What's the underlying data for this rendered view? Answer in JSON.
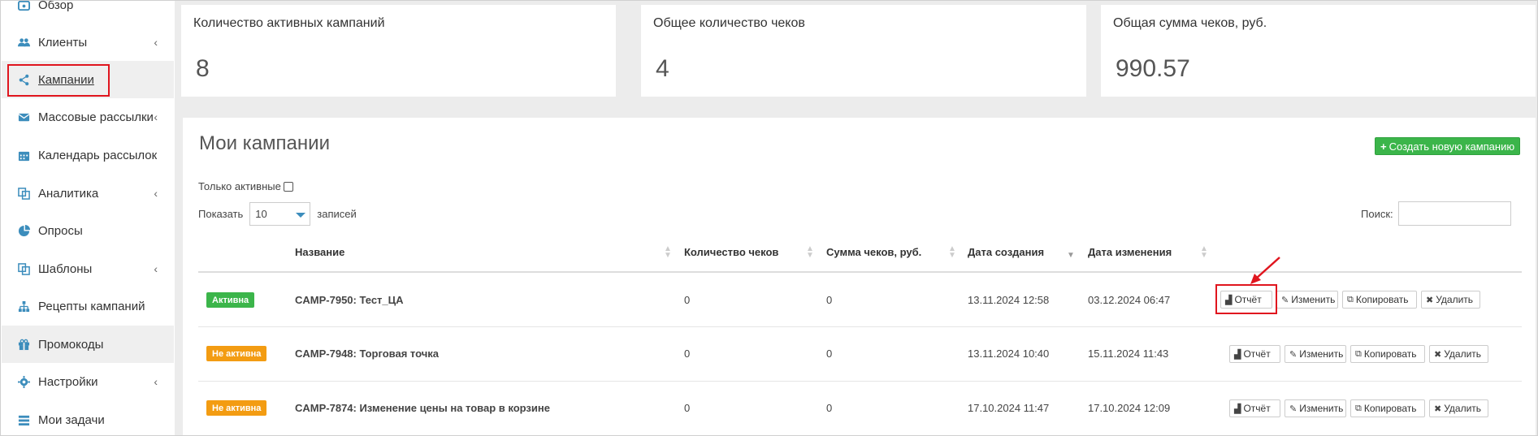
{
  "sidebar": {
    "items": [
      {
        "label": "Обзор",
        "icon": "dashboard-icon",
        "has_children": false
      },
      {
        "label": "Клиенты",
        "icon": "users-icon",
        "has_children": true
      },
      {
        "label": "Кампании",
        "icon": "share-icon",
        "has_children": false,
        "active": true
      },
      {
        "label": "Массовые рассылки",
        "icon": "envelope-icon",
        "has_children": true
      },
      {
        "label": "Календарь рассылок",
        "icon": "calendar-icon",
        "has_children": false
      },
      {
        "label": "Аналитика",
        "icon": "copy-icon",
        "has_children": true
      },
      {
        "label": "Опросы",
        "icon": "pie-chart-icon",
        "has_children": false
      },
      {
        "label": "Шаблоны",
        "icon": "copy-icon",
        "has_children": true
      },
      {
        "label": "Рецепты кампаний",
        "icon": "sitemap-icon",
        "has_children": false
      },
      {
        "label": "Промокоды",
        "icon": "gift-icon",
        "has_children": false
      },
      {
        "label": "Настройки",
        "icon": "cog-icon",
        "has_children": true
      },
      {
        "label": "Мои задачи",
        "icon": "tasks-icon",
        "has_children": false
      }
    ]
  },
  "stats": [
    {
      "title": "Количество активных кампаний",
      "value": "8"
    },
    {
      "title": "Общее количество чеков",
      "value": "4"
    },
    {
      "title": "Общая сумма чеков, руб.",
      "value": "990.57"
    }
  ],
  "panel": {
    "title": "Мои кампании",
    "create_button": "Создать новую кампанию",
    "only_active_label": "Только активные",
    "show_label": "Показать",
    "page_size": "10",
    "records_label": "записей",
    "search_label": "Поиск:"
  },
  "table": {
    "columns": [
      "Название",
      "Количество чеков",
      "Сумма чеков, руб.",
      "Дата создания",
      "Дата изменения"
    ],
    "rows": [
      {
        "status": "Активна",
        "status_color": "#3bb54a",
        "name": "CAMP-7950: Тест_ЦА",
        "checks": "0",
        "sum": "0",
        "created": "13.11.2024 12:58",
        "modified": "03.12.2024 06:47"
      },
      {
        "status": "Не активна",
        "status_color": "#f39c12",
        "name": "CAMP-7948: Торговая точка",
        "checks": "0",
        "sum": "0",
        "created": "13.11.2024 10:40",
        "modified": "15.11.2024 11:43"
      },
      {
        "status": "Не активна",
        "status_color": "#f39c12",
        "name": "CAMP-7874: Изменение цены на товар в корзине",
        "checks": "0",
        "sum": "0",
        "created": "17.10.2024 11:47",
        "modified": "17.10.2024 12:09"
      }
    ],
    "actions": [
      "Отчёт",
      "Изменить",
      "Копировать",
      "Удалить"
    ]
  },
  "colors": {
    "accent": "#3c8dbc",
    "highlight": "#e0151e",
    "success": "#3bb54a",
    "warning": "#f39c12"
  }
}
